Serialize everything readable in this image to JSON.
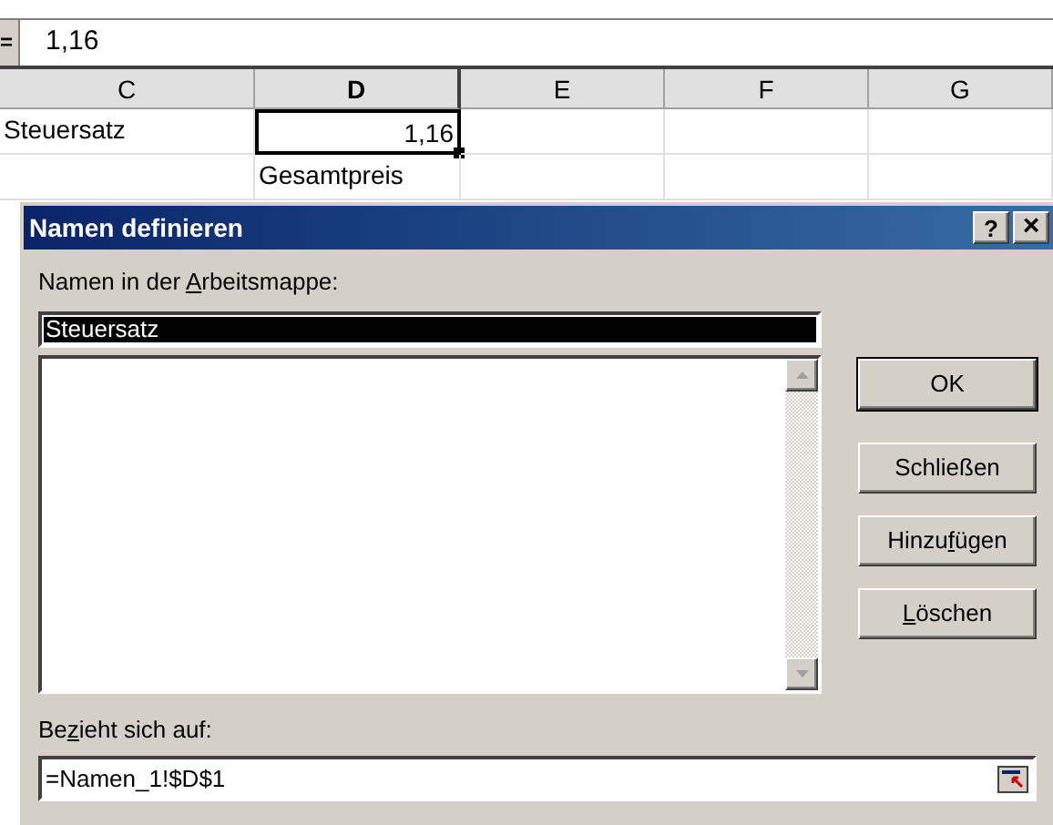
{
  "formula_bar": {
    "icon": "=",
    "value": "1,16"
  },
  "sheet": {
    "columns": [
      {
        "label": "C",
        "selected": false
      },
      {
        "label": "D",
        "selected": true
      },
      {
        "label": "E",
        "selected": false
      },
      {
        "label": "F",
        "selected": false
      },
      {
        "label": "G",
        "selected": false
      }
    ],
    "rows": [
      [
        {
          "text": "Steuersatz",
          "selected": false
        },
        {
          "text": "1,16",
          "selected": true
        },
        {
          "selected": false
        },
        {
          "selected": false
        },
        {
          "selected": false
        }
      ],
      [
        {
          "selected": false
        },
        {
          "text": "Gesamtpreis",
          "selected": false
        },
        {
          "selected": false
        },
        {
          "selected": false
        },
        {
          "selected": false
        }
      ]
    ]
  },
  "dialog": {
    "title": "Namen definieren",
    "help_button": "?",
    "close_button": "×",
    "names_label": {
      "before": "Namen in der ",
      "key": "A",
      "after": "rbeitsmappe:"
    },
    "name_field": {
      "value": "Steuersatz"
    },
    "buttons": [
      {
        "before": "OK",
        "default": true
      },
      {
        "before": "Schließen",
        "default": false
      },
      {
        "before": "Hinzu",
        "key": "f",
        "after": "ügen",
        "default": false
      },
      {
        "key": "L",
        "after": "öschen",
        "default": false
      }
    ],
    "refers_label": {
      "before": "Be",
      "key": "z",
      "after": "ieht sich auf:"
    },
    "refers_field": {
      "value": "=Namen_1!$D$1"
    }
  }
}
